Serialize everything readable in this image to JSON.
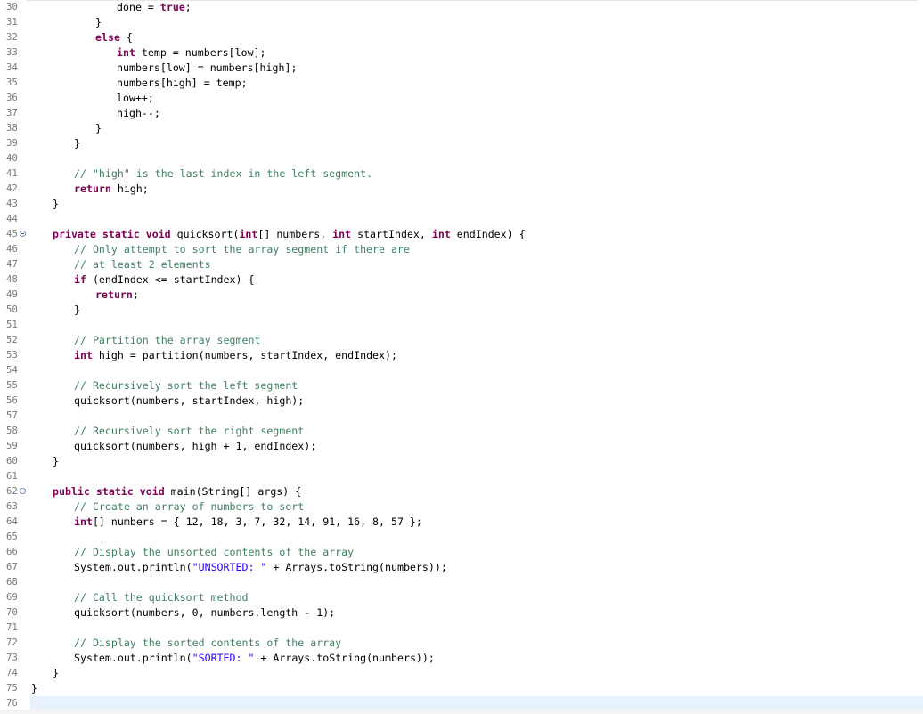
{
  "editor": {
    "lines": [
      {
        "n": "30",
        "indent": 4,
        "tokens": [
          {
            "t": "pl",
            "v": "done = "
          },
          {
            "t": "kw",
            "v": "true"
          },
          {
            "t": "pl",
            "v": ";"
          }
        ]
      },
      {
        "n": "31",
        "indent": 3,
        "tokens": [
          {
            "t": "pl",
            "v": "}"
          }
        ]
      },
      {
        "n": "32",
        "indent": 3,
        "tokens": [
          {
            "t": "kw",
            "v": "else"
          },
          {
            "t": "pl",
            "v": " {"
          }
        ]
      },
      {
        "n": "33",
        "indent": 4,
        "tokens": [
          {
            "t": "kw",
            "v": "int"
          },
          {
            "t": "pl",
            "v": " temp = numbers[low];"
          }
        ]
      },
      {
        "n": "34",
        "indent": 4,
        "tokens": [
          {
            "t": "pl",
            "v": "numbers[low] = numbers[high];"
          }
        ]
      },
      {
        "n": "35",
        "indent": 4,
        "tokens": [
          {
            "t": "pl",
            "v": "numbers[high] = temp;"
          }
        ]
      },
      {
        "n": "36",
        "indent": 4,
        "tokens": [
          {
            "t": "pl",
            "v": "low++;"
          }
        ]
      },
      {
        "n": "37",
        "indent": 4,
        "tokens": [
          {
            "t": "pl",
            "v": "high--;"
          }
        ]
      },
      {
        "n": "38",
        "indent": 3,
        "tokens": [
          {
            "t": "pl",
            "v": "}"
          }
        ]
      },
      {
        "n": "39",
        "indent": 2,
        "tokens": [
          {
            "t": "pl",
            "v": "}"
          }
        ]
      },
      {
        "n": "40",
        "indent": 0,
        "tokens": []
      },
      {
        "n": "41",
        "indent": 2,
        "tokens": [
          {
            "t": "cm",
            "v": "// \"high\" is the last index in the left segment."
          }
        ]
      },
      {
        "n": "42",
        "indent": 2,
        "tokens": [
          {
            "t": "kw",
            "v": "return"
          },
          {
            "t": "pl",
            "v": " high;"
          }
        ]
      },
      {
        "n": "43",
        "indent": 1,
        "tokens": [
          {
            "t": "pl",
            "v": "}"
          }
        ]
      },
      {
        "n": "44",
        "indent": 0,
        "tokens": []
      },
      {
        "n": "45",
        "indent": 1,
        "fold": true,
        "tokens": [
          {
            "t": "kw",
            "v": "private"
          },
          {
            "t": "pl",
            "v": " "
          },
          {
            "t": "kw",
            "v": "static"
          },
          {
            "t": "pl",
            "v": " "
          },
          {
            "t": "kw",
            "v": "void"
          },
          {
            "t": "pl",
            "v": " quicksort("
          },
          {
            "t": "kw",
            "v": "int"
          },
          {
            "t": "pl",
            "v": "[] numbers, "
          },
          {
            "t": "kw",
            "v": "int"
          },
          {
            "t": "pl",
            "v": " startIndex, "
          },
          {
            "t": "kw",
            "v": "int"
          },
          {
            "t": "pl",
            "v": " endIndex) {"
          }
        ]
      },
      {
        "n": "46",
        "indent": 2,
        "tokens": [
          {
            "t": "cm",
            "v": "// Only attempt to sort the array segment if there are"
          }
        ]
      },
      {
        "n": "47",
        "indent": 2,
        "tokens": [
          {
            "t": "cm",
            "v": "// at least 2 elements"
          }
        ]
      },
      {
        "n": "48",
        "indent": 2,
        "tokens": [
          {
            "t": "kw",
            "v": "if"
          },
          {
            "t": "pl",
            "v": " (endIndex <= startIndex) {"
          }
        ]
      },
      {
        "n": "49",
        "indent": 3,
        "tokens": [
          {
            "t": "kw",
            "v": "return"
          },
          {
            "t": "pl",
            "v": ";"
          }
        ]
      },
      {
        "n": "50",
        "indent": 2,
        "tokens": [
          {
            "t": "pl",
            "v": "}"
          }
        ]
      },
      {
        "n": "51",
        "indent": 0,
        "tokens": []
      },
      {
        "n": "52",
        "indent": 2,
        "tokens": [
          {
            "t": "cm",
            "v": "// Partition the array segment"
          }
        ]
      },
      {
        "n": "53",
        "indent": 2,
        "tokens": [
          {
            "t": "kw",
            "v": "int"
          },
          {
            "t": "pl",
            "v": " high = partition(numbers, startIndex, endIndex);"
          }
        ]
      },
      {
        "n": "54",
        "indent": 0,
        "tokens": []
      },
      {
        "n": "55",
        "indent": 2,
        "tokens": [
          {
            "t": "cm",
            "v": "// Recursively sort the left segment"
          }
        ]
      },
      {
        "n": "56",
        "indent": 2,
        "tokens": [
          {
            "t": "pl",
            "v": "quicksort(numbers, startIndex, high);"
          }
        ]
      },
      {
        "n": "57",
        "indent": 0,
        "tokens": []
      },
      {
        "n": "58",
        "indent": 2,
        "tokens": [
          {
            "t": "cm",
            "v": "// Recursively sort the right segment"
          }
        ]
      },
      {
        "n": "59",
        "indent": 2,
        "tokens": [
          {
            "t": "pl",
            "v": "quicksort(numbers, high + 1, endIndex);"
          }
        ]
      },
      {
        "n": "60",
        "indent": 1,
        "tokens": [
          {
            "t": "pl",
            "v": "}"
          }
        ]
      },
      {
        "n": "61",
        "indent": 0,
        "tokens": []
      },
      {
        "n": "62",
        "indent": 1,
        "fold": true,
        "tokens": [
          {
            "t": "kw",
            "v": "public"
          },
          {
            "t": "pl",
            "v": " "
          },
          {
            "t": "kw",
            "v": "static"
          },
          {
            "t": "pl",
            "v": " "
          },
          {
            "t": "kw",
            "v": "void"
          },
          {
            "t": "pl",
            "v": " main(String[] args) {"
          }
        ]
      },
      {
        "n": "63",
        "indent": 2,
        "tokens": [
          {
            "t": "cm",
            "v": "// Create an array of numbers to sort"
          }
        ]
      },
      {
        "n": "64",
        "indent": 2,
        "tokens": [
          {
            "t": "kw",
            "v": "int"
          },
          {
            "t": "pl",
            "v": "[] numbers = { 12, 18, 3, 7, 32, 14, 91, 16, 8, 57 };"
          }
        ]
      },
      {
        "n": "65",
        "indent": 0,
        "tokens": []
      },
      {
        "n": "66",
        "indent": 2,
        "tokens": [
          {
            "t": "cm",
            "v": "// Display the unsorted contents of the array"
          }
        ]
      },
      {
        "n": "67",
        "indent": 2,
        "tokens": [
          {
            "t": "pl",
            "v": "System.out.println("
          },
          {
            "t": "st",
            "v": "\"UNSORTED: \""
          },
          {
            "t": "pl",
            "v": " + Arrays.toString(numbers));"
          }
        ]
      },
      {
        "n": "68",
        "indent": 0,
        "tokens": []
      },
      {
        "n": "69",
        "indent": 2,
        "tokens": [
          {
            "t": "cm",
            "v": "// Call the quicksort method"
          }
        ]
      },
      {
        "n": "70",
        "indent": 2,
        "tokens": [
          {
            "t": "pl",
            "v": "quicksort(numbers, 0, numbers.length - 1);"
          }
        ]
      },
      {
        "n": "71",
        "indent": 0,
        "tokens": []
      },
      {
        "n": "72",
        "indent": 2,
        "tokens": [
          {
            "t": "cm",
            "v": "// Display the sorted contents of the array"
          }
        ]
      },
      {
        "n": "73",
        "indent": 2,
        "tokens": [
          {
            "t": "pl",
            "v": "System.out.println("
          },
          {
            "t": "st",
            "v": "\"SORTED: \""
          },
          {
            "t": "pl",
            "v": " + Arrays.toString(numbers));"
          }
        ]
      },
      {
        "n": "74",
        "indent": 1,
        "tokens": [
          {
            "t": "pl",
            "v": "}"
          }
        ]
      },
      {
        "n": "75",
        "indent": 0,
        "tokens": [
          {
            "t": "pl",
            "v": "}"
          }
        ]
      },
      {
        "n": "76",
        "indent": 0,
        "current": true,
        "tokens": []
      }
    ]
  },
  "colors": {
    "keyword": "#7f0055",
    "comment": "#3f7f5f",
    "string": "#2a00ff",
    "line_number": "#787878",
    "current_line": "#e8f2fe"
  },
  "icons": {
    "fold": "fold-collapse-icon"
  }
}
